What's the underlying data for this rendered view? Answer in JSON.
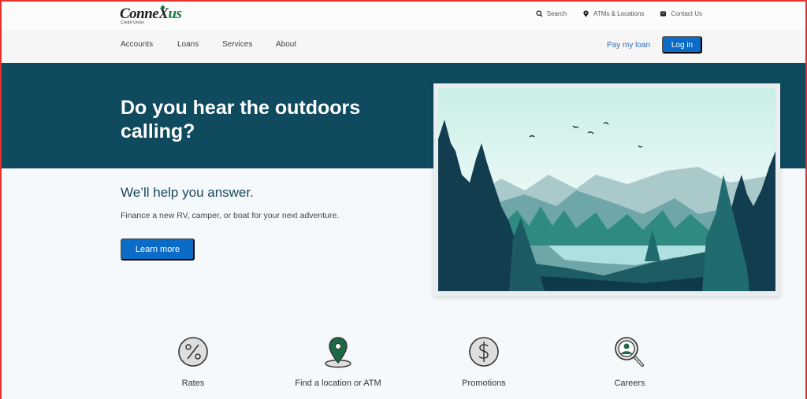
{
  "brand": {
    "name_part1": "Conne",
    "name_x": "X",
    "name_part2": "us",
    "tagline": "Credit Union",
    "colors": {
      "green": "#1b7a43",
      "navy": "#0f4a5f",
      "blue": "#0a6cc7"
    }
  },
  "utility": {
    "links": [
      {
        "icon": "search-icon",
        "label": "Search"
      },
      {
        "icon": "location-pin-icon",
        "label": "ATMs & Locations"
      },
      {
        "icon": "chat-icon",
        "label": "Contact Us"
      }
    ]
  },
  "nav": {
    "items": [
      "Accounts",
      "Loans",
      "Services",
      "About"
    ],
    "pay_loan": "Pay my loan",
    "login": "Log in"
  },
  "hero": {
    "title": "Do you hear the outdoors calling?",
    "subtitle": "We’ll help you answer.",
    "description": "Finance a new RV, camper, or boat for your next adventure.",
    "cta": "Learn more",
    "image_alt": "Forest and mountain lake landscape illustration with birds"
  },
  "quick_links": [
    {
      "icon": "percent-icon",
      "label": "Rates"
    },
    {
      "icon": "map-pin-icon",
      "label": "Find a location or ATM"
    },
    {
      "icon": "dollar-icon",
      "label": "Promotions"
    },
    {
      "icon": "careers-search-icon",
      "label": "Careers"
    }
  ]
}
